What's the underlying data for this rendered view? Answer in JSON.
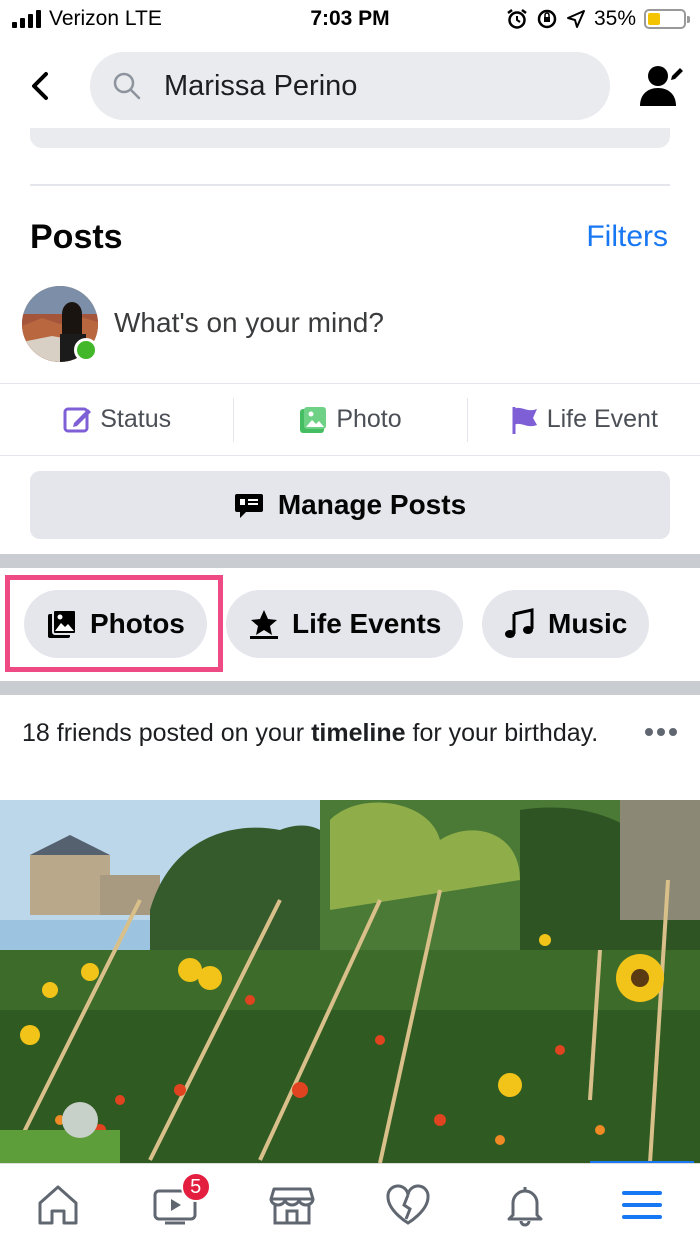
{
  "status_bar": {
    "carrier": "Verizon LTE",
    "time": "7:03 PM",
    "battery": "35%",
    "battery_level": 0.35
  },
  "header": {
    "search_value": "Marissa Perino"
  },
  "posts": {
    "title": "Posts",
    "filters_label": "Filters",
    "composer_placeholder": "What's on your mind?",
    "actions": [
      {
        "label": "Status",
        "icon": "edit-square-icon",
        "color": "#7e5fd6"
      },
      {
        "label": "Photo",
        "icon": "photo-icon",
        "color": "#45bd62"
      },
      {
        "label": "Life Event",
        "icon": "flag-icon",
        "color": "#7e5fd6"
      }
    ],
    "manage_label": "Manage Posts"
  },
  "chips": [
    {
      "label": "Photos",
      "icon": "photos-icon"
    },
    {
      "label": "Life Events",
      "icon": "star-icon"
    },
    {
      "label": "Music",
      "icon": "music-note-icon"
    }
  ],
  "feed_post": {
    "text_before": "18 friends posted on your ",
    "text_bold": "timeline",
    "text_after": " for your birthday."
  },
  "bottom_nav": {
    "items": [
      "home-icon",
      "watch-icon",
      "marketplace-icon",
      "dating-heart-icon",
      "bell-icon",
      "menu-icon"
    ],
    "watch_badge": "5"
  },
  "colors": {
    "accent": "#1877f2",
    "highlight": "#ee4b84",
    "badge": "#e41e3f",
    "online": "#42b72a"
  }
}
